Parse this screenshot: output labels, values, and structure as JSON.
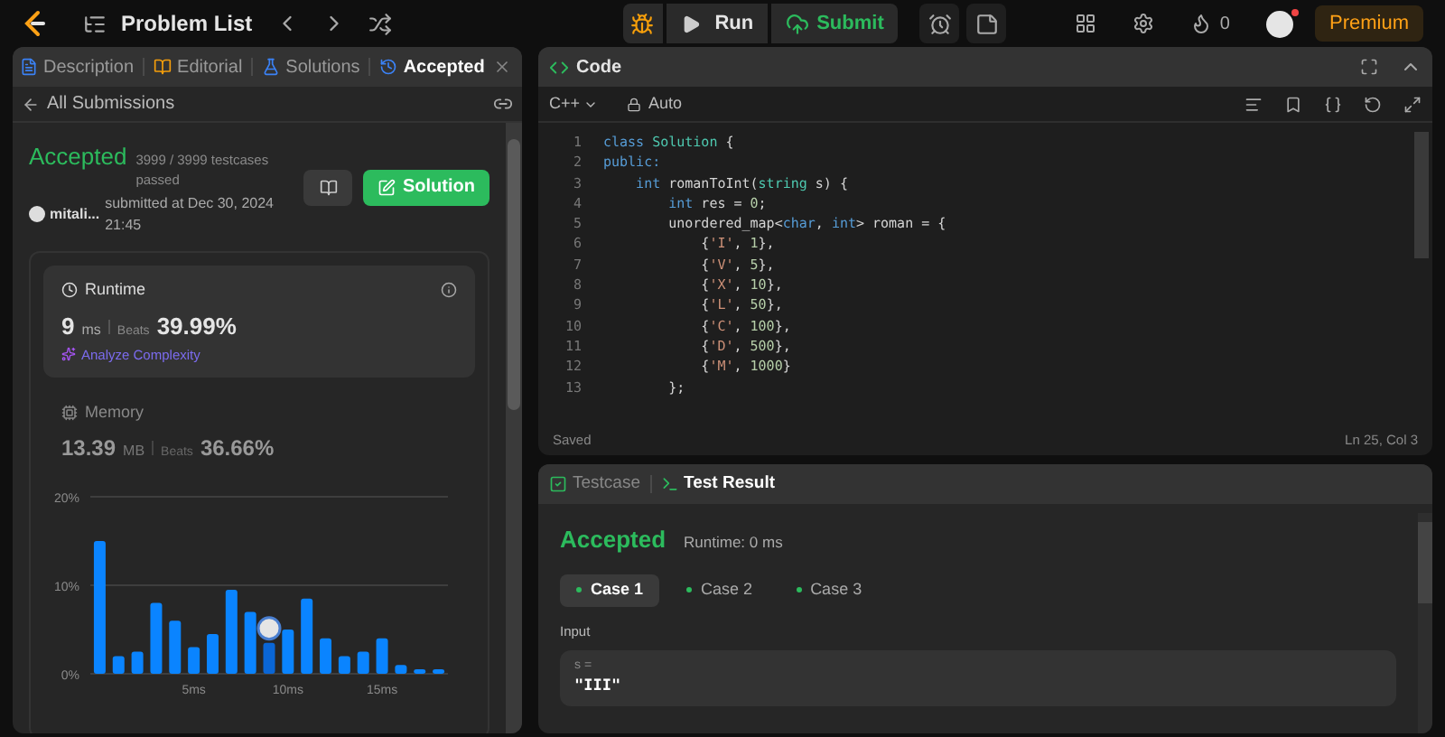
{
  "topbar": {
    "title": "Problem List",
    "run": "Run",
    "submit": "Submit",
    "streak": "0",
    "premium": "Premium"
  },
  "left_tabs": [
    {
      "label": "Description",
      "selected": false
    },
    {
      "label": "Editorial",
      "selected": false
    },
    {
      "label": "Solutions",
      "selected": false
    },
    {
      "label": "Accepted",
      "selected": true
    }
  ],
  "back_link": "All Submissions",
  "submission": {
    "status": "Accepted",
    "passed": "3999 / 3999 testcases passed",
    "user": "mitali...",
    "submitted": "submitted at Dec 30, 2024 21:45",
    "solution_button": "Solution"
  },
  "runtime": {
    "title": "Runtime",
    "value": "9",
    "unit": "ms",
    "beats_label": "Beats",
    "beats": "39.99%",
    "analyze": "Analyze Complexity"
  },
  "memory": {
    "title": "Memory",
    "value": "13.39",
    "unit": "MB",
    "beats_label": "Beats",
    "beats": "36.66%"
  },
  "chart_data": {
    "type": "bar",
    "x": [
      0,
      1,
      2,
      3,
      4,
      5,
      6,
      7,
      8,
      9,
      10,
      11,
      12,
      13,
      14,
      15,
      16,
      17,
      18
    ],
    "values": [
      15,
      2,
      2.5,
      8,
      6,
      3,
      4.5,
      9.5,
      7,
      3.5,
      5,
      8.5,
      4,
      2,
      2.5,
      4,
      1,
      0.5,
      0.5
    ],
    "xlim": [
      -0.5,
      18.5
    ],
    "ylim": [
      0,
      20
    ],
    "yticks": [
      {
        "value": 0,
        "label": "0%"
      },
      {
        "value": 10,
        "label": "10%"
      },
      {
        "value": 20,
        "label": "20%"
      }
    ],
    "xticks": [
      {
        "value": 5,
        "label": "5ms"
      },
      {
        "value": 10,
        "label": "10ms"
      },
      {
        "value": 15,
        "label": "15ms"
      }
    ]
  },
  "code_panel": {
    "title": "Code",
    "language": "C++",
    "mode": "Auto",
    "status": "Saved",
    "cursor": "Ln 25, Col 3",
    "lines": [
      [
        {
          "t": "class ",
          "kind": "kw"
        },
        {
          "t": "Solution",
          "kind": "type"
        },
        {
          "t": " {",
          "kind": "p"
        }
      ],
      [
        {
          "t": "public:",
          "kind": "kw"
        }
      ],
      [
        {
          "t": "    int",
          "kind": "kw"
        },
        {
          "t": " romanToInt(",
          "kind": "p"
        },
        {
          "t": "string",
          "kind": "type"
        },
        {
          "t": " s) {",
          "kind": "p"
        }
      ],
      [
        {
          "t": "        int",
          "kind": "kw"
        },
        {
          "t": " res = ",
          "kind": "p"
        },
        {
          "t": "0",
          "kind": "num"
        },
        {
          "t": ";",
          "kind": "p"
        }
      ],
      [
        {
          "t": "        unordered_map<",
          "kind": "p"
        },
        {
          "t": "char",
          "kind": "kw"
        },
        {
          "t": ", ",
          "kind": "p"
        },
        {
          "t": "int",
          "kind": "kw"
        },
        {
          "t": "> roman = {",
          "kind": "p"
        }
      ],
      [
        {
          "t": "            {",
          "kind": "p"
        },
        {
          "t": "'I'",
          "kind": "str"
        },
        {
          "t": ", ",
          "kind": "p"
        },
        {
          "t": "1",
          "kind": "num"
        },
        {
          "t": "},",
          "kind": "p"
        }
      ],
      [
        {
          "t": "            {",
          "kind": "p"
        },
        {
          "t": "'V'",
          "kind": "str"
        },
        {
          "t": ", ",
          "kind": "p"
        },
        {
          "t": "5",
          "kind": "num"
        },
        {
          "t": "},",
          "kind": "p"
        }
      ],
      [
        {
          "t": "            {",
          "kind": "p"
        },
        {
          "t": "'X'",
          "kind": "str"
        },
        {
          "t": ", ",
          "kind": "p"
        },
        {
          "t": "10",
          "kind": "num"
        },
        {
          "t": "},",
          "kind": "p"
        }
      ],
      [
        {
          "t": "            {",
          "kind": "p"
        },
        {
          "t": "'L'",
          "kind": "str"
        },
        {
          "t": ", ",
          "kind": "p"
        },
        {
          "t": "50",
          "kind": "num"
        },
        {
          "t": "},",
          "kind": "p"
        }
      ],
      [
        {
          "t": "            {",
          "kind": "p"
        },
        {
          "t": "'C'",
          "kind": "str"
        },
        {
          "t": ", ",
          "kind": "p"
        },
        {
          "t": "100",
          "kind": "num"
        },
        {
          "t": "},",
          "kind": "p"
        }
      ],
      [
        {
          "t": "            {",
          "kind": "p"
        },
        {
          "t": "'D'",
          "kind": "str"
        },
        {
          "t": ", ",
          "kind": "p"
        },
        {
          "t": "500",
          "kind": "num"
        },
        {
          "t": "},",
          "kind": "p"
        }
      ],
      [
        {
          "t": "            {",
          "kind": "p"
        },
        {
          "t": "'M'",
          "kind": "str"
        },
        {
          "t": ", ",
          "kind": "p"
        },
        {
          "t": "1000",
          "kind": "num"
        },
        {
          "t": "}",
          "kind": "p"
        }
      ],
      [
        {
          "t": "        };",
          "kind": "p"
        }
      ]
    ],
    "line_numbers": [
      "1",
      "2",
      "3",
      "4",
      "5",
      "6",
      "7",
      "8",
      "9",
      "10",
      "11",
      "12",
      "13"
    ]
  },
  "bottom_tabs": [
    {
      "label": "Testcase",
      "selected": false
    },
    {
      "label": "Test Result",
      "selected": true
    }
  ],
  "result": {
    "status": "Accepted",
    "runtime": "Runtime: 0 ms",
    "input_label": "Input",
    "var": "s =",
    "value": "\"III\""
  },
  "cases": [
    {
      "label": "Case 1",
      "selected": true
    },
    {
      "label": "Case 2",
      "selected": false
    },
    {
      "label": "Case 3",
      "selected": false
    }
  ]
}
